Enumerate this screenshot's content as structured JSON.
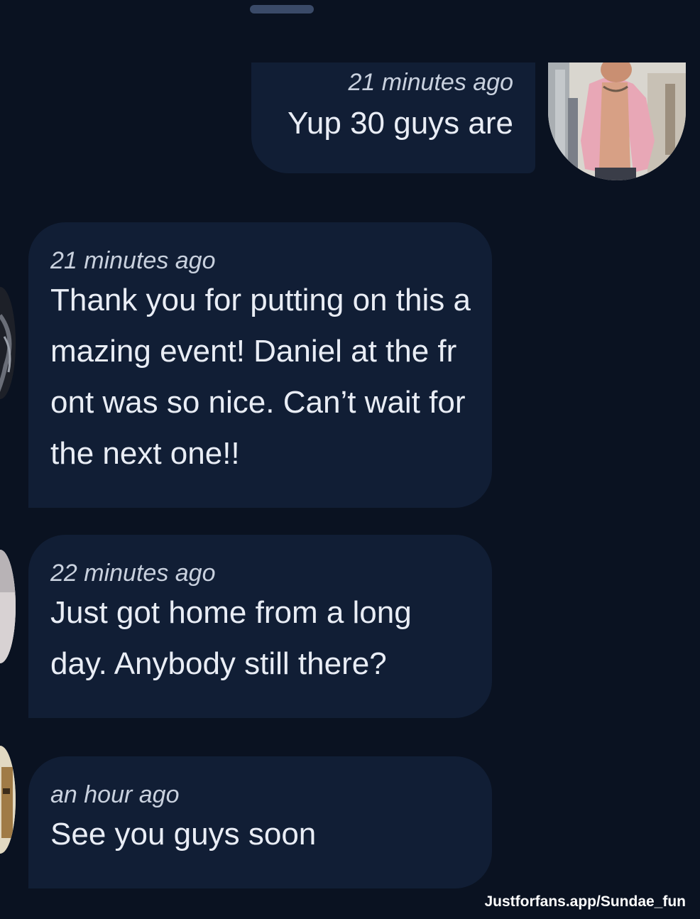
{
  "messages": [
    {
      "direction": "outgoing",
      "timestamp": "21 minutes ago",
      "text": "Yup 30 guys are"
    },
    {
      "direction": "incoming",
      "timestamp": "21 minutes ago",
      "text": "Thank you for putting on this amazing event! Daniel at the front was so nice. Can’t wait for the next one!!"
    },
    {
      "direction": "incoming",
      "timestamp": "22 minutes ago",
      "text": "Just got home from a long day. Anybody still there?"
    },
    {
      "direction": "incoming",
      "timestamp": "an hour ago",
      "text": "See you guys soon"
    }
  ],
  "watermark": "Justforfans.app/Sundae_fun",
  "colors": {
    "background": "#0a1221",
    "bubble": "#111e35",
    "handle": "#3a4a68"
  }
}
